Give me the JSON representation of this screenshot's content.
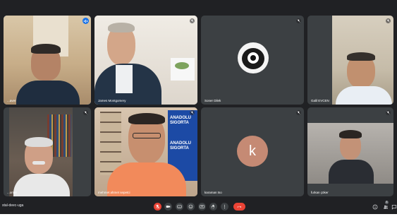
{
  "meeting": {
    "code": "stal-deec-uga"
  },
  "participants": [
    {
      "name": "...aver",
      "avatar_letter": ""
    },
    {
      "name": "James Montgomery",
      "avatar_letter": ""
    },
    {
      "name": "Soner Dilek",
      "avatar_letter": ""
    },
    {
      "name": "Galil EVCEN",
      "avatar_letter": ""
    },
    {
      "name": "...omer",
      "avatar_letter": ""
    },
    {
      "name": "mehmet ahmet sepetci",
      "avatar_letter": ""
    },
    {
      "name": "karaman tso",
      "avatar_letter": "k"
    },
    {
      "name": "furkan çöker",
      "avatar_letter": ""
    }
  ],
  "banner_text": {
    "line1": "ANADOLU",
    "line2": "SIGORTA",
    "line3": "ANADOLU",
    "line4": "SIGORTA"
  },
  "people_count": "8",
  "colors": {
    "bg": "#202124",
    "tile": "#3c4043",
    "end_call": "#ea4335",
    "active_border": "#8ab4f8",
    "avatar": "#c58a74"
  },
  "icons": {
    "controls": [
      "mic-off-icon",
      "camera-icon",
      "captions-icon",
      "emoji-icon",
      "present-icon",
      "raise-hand-icon",
      "more-options-icon",
      "end-call-icon"
    ],
    "right": [
      "info-icon",
      "people-icon",
      "chat-icon"
    ]
  }
}
